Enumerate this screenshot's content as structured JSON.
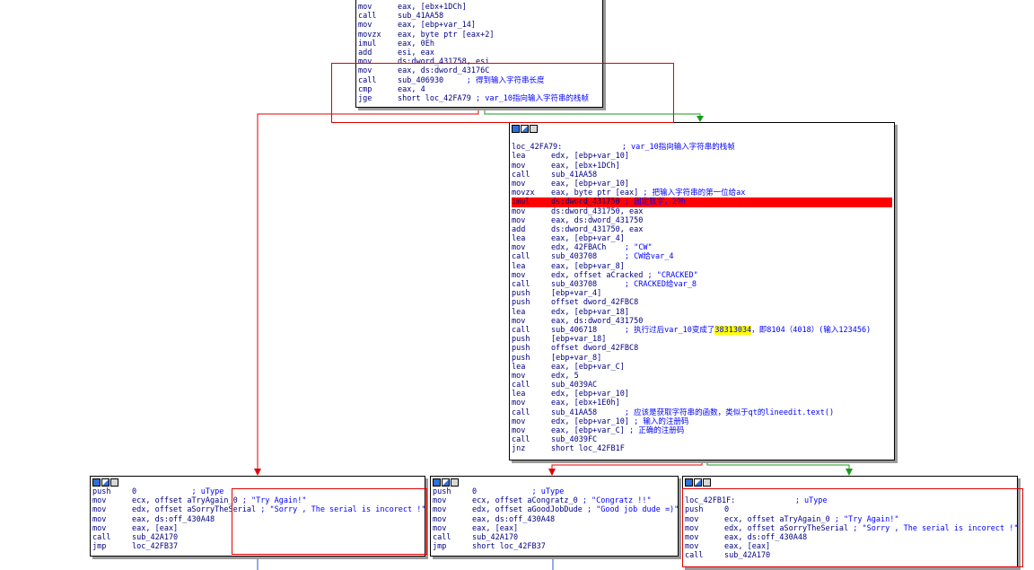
{
  "colors": {
    "edge_true": "#1a9a1a",
    "edge_false": "#e00000",
    "edge_uncond": "#3050d0",
    "highlight": "#ff0000",
    "mnemonic": "#000080",
    "comment": "#0000ff"
  },
  "blocks": [
    {
      "id": "block-top",
      "lines": [
        {
          "m": "mov",
          "ops": "eax, [ebx+1DCh]",
          "c": ""
        },
        {
          "m": "call",
          "ops": "sub_41AA58",
          "c": ""
        },
        {
          "m": "mov",
          "ops": "eax, [ebp+var_14]",
          "c": ""
        },
        {
          "m": "movzx",
          "ops": "eax, byte ptr [eax+2]",
          "c": ""
        },
        {
          "m": "imul",
          "ops": "eax, 0Eh",
          "c": ""
        },
        {
          "m": "add",
          "ops": "esi, eax",
          "c": ""
        },
        {
          "m": "mov",
          "ops": "ds:dword_431758, esi",
          "c": ""
        },
        {
          "m": "mov",
          "ops": "eax, ds:dword_43176C",
          "c": ""
        },
        {
          "m": "call",
          "ops": "sub_406930",
          "c": "     ; 得到输入字符串长度"
        },
        {
          "m": "cmp",
          "ops": "eax, 4",
          "c": ""
        },
        {
          "m": "jge",
          "ops": "short loc_42FA79",
          "c": " ; var_10指向输入字符串的栈帧"
        }
      ]
    },
    {
      "id": "block-loc-42fa79",
      "lines": [
        {
          "m": "",
          "ops": "",
          "c": ""
        },
        {
          "label": "loc_42FA79:",
          "c": "             ; var_10指向输入字符串的栈帧"
        },
        {
          "m": "lea",
          "ops": "edx, [ebp+var_10]",
          "c": ""
        },
        {
          "m": "mov",
          "ops": "eax, [ebx+1DCh]",
          "c": ""
        },
        {
          "m": "call",
          "ops": "sub_41AA58",
          "c": ""
        },
        {
          "m": "mov",
          "ops": "eax, [ebp+var_10]",
          "c": ""
        },
        {
          "m": "movzx",
          "ops": "eax, byte ptr [eax]",
          "c": " ; 把输入字符串的第一位给ax"
        },
        {
          "m": "imul",
          "ops": "ds:dword_431750",
          "c": " ; 固定数字，29h",
          "hl": true
        },
        {
          "m": "mov",
          "ops": "ds:dword_431750, eax",
          "c": ""
        },
        {
          "m": "mov",
          "ops": "eax, ds:dword_431750",
          "c": ""
        },
        {
          "m": "add",
          "ops": "ds:dword_431750, eax",
          "c": ""
        },
        {
          "m": "lea",
          "ops": "eax, [ebp+var_4]",
          "c": ""
        },
        {
          "m": "mov",
          "ops": "edx, 42FBACh",
          "c": "    ; \"CW\""
        },
        {
          "m": "call",
          "ops": "sub_403708",
          "c": "      ; CW给var_4"
        },
        {
          "m": "lea",
          "ops": "eax, [ebp+var_8]",
          "c": ""
        },
        {
          "m": "mov",
          "ops": "edx, offset aCracked",
          "c": " ; \"CRACKED\""
        },
        {
          "m": "call",
          "ops": "sub_403708",
          "c": "      ; CRACKED给var_8"
        },
        {
          "m": "push",
          "ops": "[ebp+var_4]",
          "c": ""
        },
        {
          "m": "push",
          "ops": "offset dword_42FBC8",
          "c": ""
        },
        {
          "m": "lea",
          "ops": "edx, [ebp+var_18]",
          "c": ""
        },
        {
          "m": "mov",
          "ops": "eax, ds:dword_431750",
          "c": ""
        },
        {
          "m": "call",
          "ops": "sub_406718",
          "c": "      ; 执行过后var_10变成了",
          "yel": "38313034",
          "c2": "，即8104（4018）(输入123456)"
        },
        {
          "m": "push",
          "ops": "[ebp+var_18]",
          "c": ""
        },
        {
          "m": "push",
          "ops": "offset dword_42FBC8",
          "c": ""
        },
        {
          "m": "push",
          "ops": "[ebp+var_8]",
          "c": ""
        },
        {
          "m": "lea",
          "ops": "eax, [ebp+var_C]",
          "c": ""
        },
        {
          "m": "mov",
          "ops": "edx, 5",
          "c": ""
        },
        {
          "m": "call",
          "ops": "sub_4039AC",
          "c": ""
        },
        {
          "m": "lea",
          "ops": "edx, [ebp+var_10]",
          "c": ""
        },
        {
          "m": "mov",
          "ops": "eax, [ebx+1E0h]",
          "c": ""
        },
        {
          "m": "call",
          "ops": "sub_41AA58",
          "c": "      ; 应该是获取字符串的函数，类似于qt的lineedit.text()"
        },
        {
          "m": "mov",
          "ops": "edx, [ebp+var_10]",
          "c": " ; 输入的注册码"
        },
        {
          "m": "mov",
          "ops": "eax, [ebp+var_C]",
          "c": " ; 正确的注册码"
        },
        {
          "m": "call",
          "ops": "sub_4039FC",
          "c": ""
        },
        {
          "m": "jnz",
          "ops": "short loc_42FB1F",
          "c": ""
        }
      ]
    },
    {
      "id": "block-try-again",
      "lines": [
        {
          "m": "push",
          "ops": "0",
          "c": "            ; uType"
        },
        {
          "m": "mov",
          "ops": "ecx, offset aTryAgain_0",
          "c": " ; \"Try Again!\""
        },
        {
          "m": "mov",
          "ops": "edx, offset aSorryTheSerial",
          "c": " ; \"Sorry , The serial is incorect !\""
        },
        {
          "m": "mov",
          "ops": "eax, ds:off_430A48",
          "c": ""
        },
        {
          "m": "mov",
          "ops": "eax, [eax]",
          "c": ""
        },
        {
          "m": "call",
          "ops": "sub_42A170",
          "c": ""
        },
        {
          "m": "jmp",
          "ops": "loc_42FB37",
          "c": ""
        }
      ]
    },
    {
      "id": "block-congratz",
      "lines": [
        {
          "m": "push",
          "ops": "0",
          "c": "            ; uType"
        },
        {
          "m": "mov",
          "ops": "ecx, offset aCongratz_0",
          "c": " ; \"Congratz !!\""
        },
        {
          "m": "mov",
          "ops": "edx, offset aGoodJobDude",
          "c": " ; \"Good job dude =)\""
        },
        {
          "m": "mov",
          "ops": "eax, ds:off_430A48",
          "c": ""
        },
        {
          "m": "mov",
          "ops": "eax, [eax]",
          "c": ""
        },
        {
          "m": "call",
          "ops": "sub_42A170",
          "c": ""
        },
        {
          "m": "jmp",
          "ops": "short loc_42FB37",
          "c": ""
        }
      ]
    },
    {
      "id": "block-loc-42fb1f",
      "lines": [
        {
          "m": "",
          "ops": "",
          "c": ""
        },
        {
          "label": "loc_42FB1F:",
          "c": "             ; uType"
        },
        {
          "m": "push",
          "ops": "0",
          "c": ""
        },
        {
          "m": "mov",
          "ops": "ecx, offset aTryAgain_0",
          "c": " ; \"Try Again!\""
        },
        {
          "m": "mov",
          "ops": "edx, offset aSorryTheSerial",
          "c": " ; \"Sorry , The serial is incorect !\""
        },
        {
          "m": "mov",
          "ops": "eax, ds:off_430A48",
          "c": ""
        },
        {
          "m": "mov",
          "ops": "eax, [eax]",
          "c": ""
        },
        {
          "m": "call",
          "ops": "sub_42A170",
          "c": ""
        }
      ]
    }
  ]
}
